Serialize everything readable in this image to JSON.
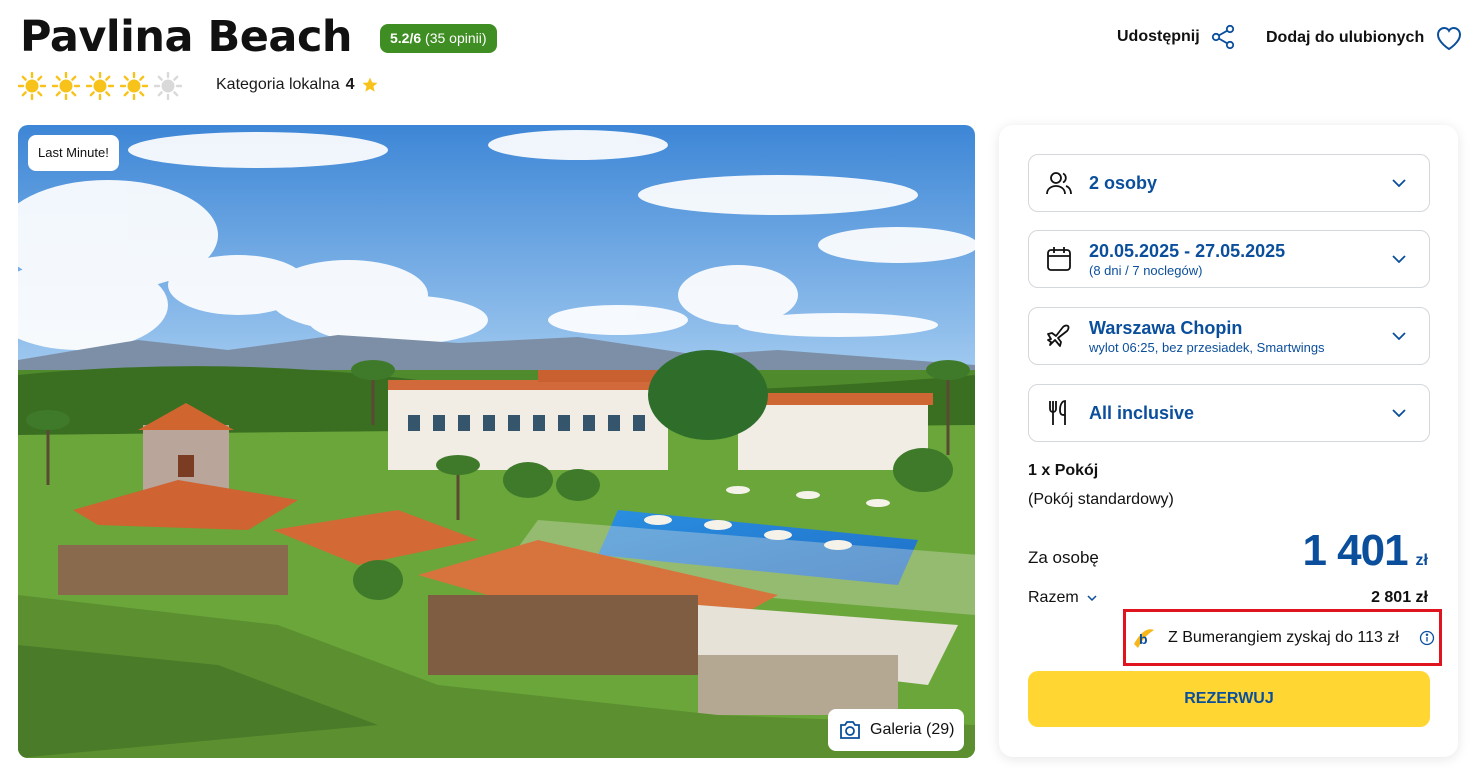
{
  "hotel": {
    "title": "Pavlina Beach",
    "rating_score": "5.2/6",
    "rating_count": "(35 opinii)",
    "suns_filled": 4,
    "suns_total": 5,
    "category_label": "Kategoria lokalna",
    "category_value": "4"
  },
  "actions": {
    "share_label": "Udostępnij",
    "favorite_label": "Dodaj do ulubionych"
  },
  "hero": {
    "badge": "Last Minute!",
    "gallery_label": "Galeria (29)"
  },
  "booking": {
    "guests": "2 osoby",
    "dates": "20.05.2025 - 27.05.2025",
    "dates_sub": "(8 dni / 7 noclegów)",
    "airport": "Warszawa Chopin",
    "airport_sub": "wylot 06:25, bez przesiadek, Smartwings",
    "board": "All inclusive",
    "room_count": "1 x Pokój",
    "room_type": "(Pokój standardowy)",
    "per_person_label": "Za osobę",
    "per_person_price": "1 401",
    "currency": "zł",
    "total_label": "Razem",
    "total_value": "2 801 zł",
    "bumerang_text": "Z Bumerangiem zyskaj do 113 zł",
    "book_button": "REZERWUJ"
  },
  "colors": {
    "accent_blue": "#0b4f9c",
    "rating_green": "#3f8e23",
    "button_yellow": "#ffd632",
    "highlight_red": "#e0141e"
  }
}
